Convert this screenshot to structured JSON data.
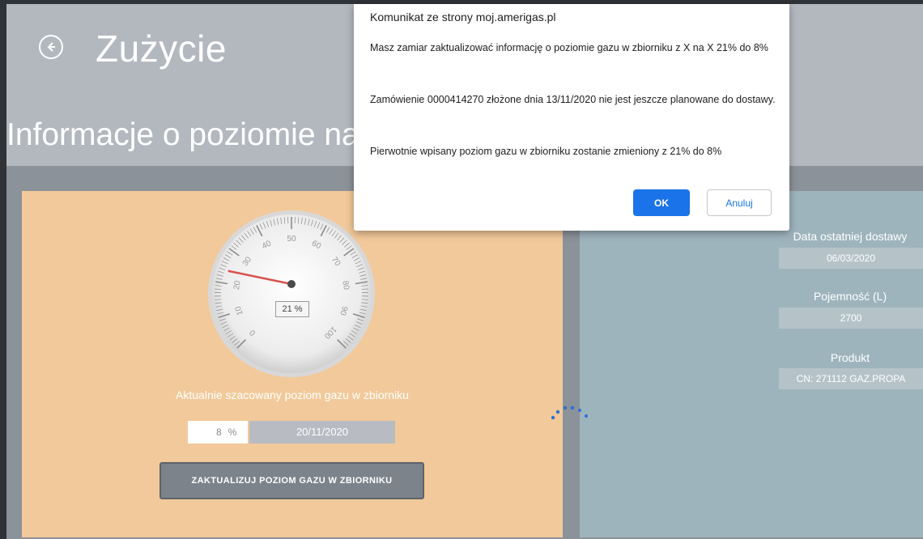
{
  "header": {
    "title": "Zużycie",
    "subtitle": "Informacje o poziomie na"
  },
  "gauge": {
    "reading": "21 %",
    "level_percent": 21,
    "scale_labels": [
      "0",
      "10",
      "20",
      "30",
      "40",
      "50",
      "60",
      "70",
      "80",
      "90",
      "100"
    ]
  },
  "gas_level": {
    "label": "Aktualnie szacowany poziom gazu w zbiorniku",
    "percent_value": "8",
    "percent_unit": "%",
    "date": "20/11/2020",
    "update_button": "ZAKTUALIZUJ POZIOM GAZU W ZBIORNIKU"
  },
  "info": {
    "last_delivery_label": "Data ostatniej dostawy",
    "last_delivery_value": "06/03/2020",
    "capacity_label": "Pojemność (L)",
    "capacity_value": "2700",
    "product_label": "Produkt",
    "product_value": "CN: 271112 GAZ.PROPA"
  },
  "dialog": {
    "title": "Komunikat ze strony moj.amerigas.pl",
    "message1": "Masz zamiar zaktualizować informację o poziomie gazu w zbiorniku z X na X 21% do 8%",
    "message2": "Zamówienie  0000414270 złożone dnia  13/11/2020 nie jest jeszcze planowane do dostawy.",
    "message3": "Pierwotnie wpisany poziom gazu w zbiorniku zostanie zmieniony z  21% do 8%",
    "ok_label": "OK",
    "cancel_label": "Anuluj"
  },
  "colors": {
    "header_bg": "#b3b8bf",
    "content_bg": "#8c9299",
    "orange_panel": "#f2c99a",
    "blue_panel": "#9eb4bd",
    "dialog_ok": "#1a73e8",
    "gauge_needle": "#d9534f"
  }
}
